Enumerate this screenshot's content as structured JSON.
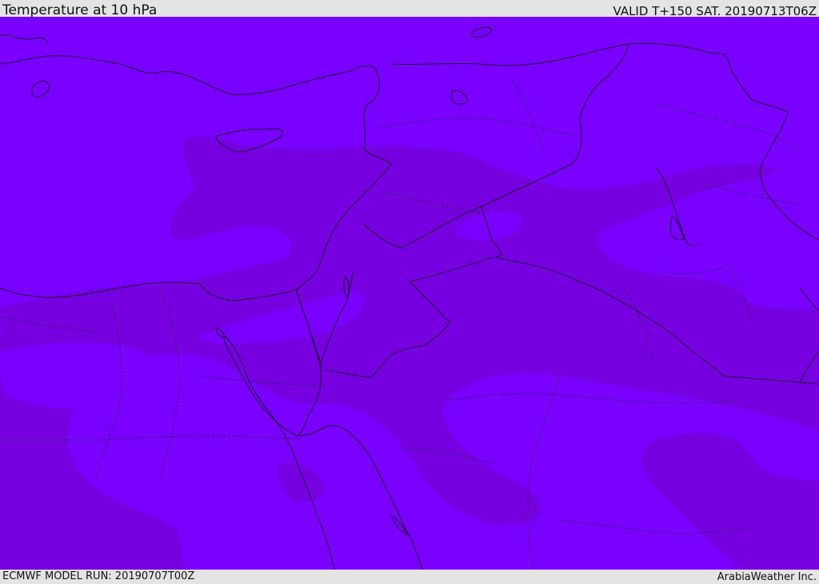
{
  "header": {
    "title": "Temperature at 10 hPa",
    "valid": "VALID T+150 SAT. 20190713T06Z"
  },
  "footer": {
    "model_run": "ECMWF MODEL RUN: 20190707T00Z",
    "credit": "ArabiaWeather Inc."
  },
  "colors": {
    "background_field": "#7a00ff",
    "warmer_band": "#7600e0",
    "outline": "#1c0a3a",
    "frame": "#e4e4e4"
  }
}
